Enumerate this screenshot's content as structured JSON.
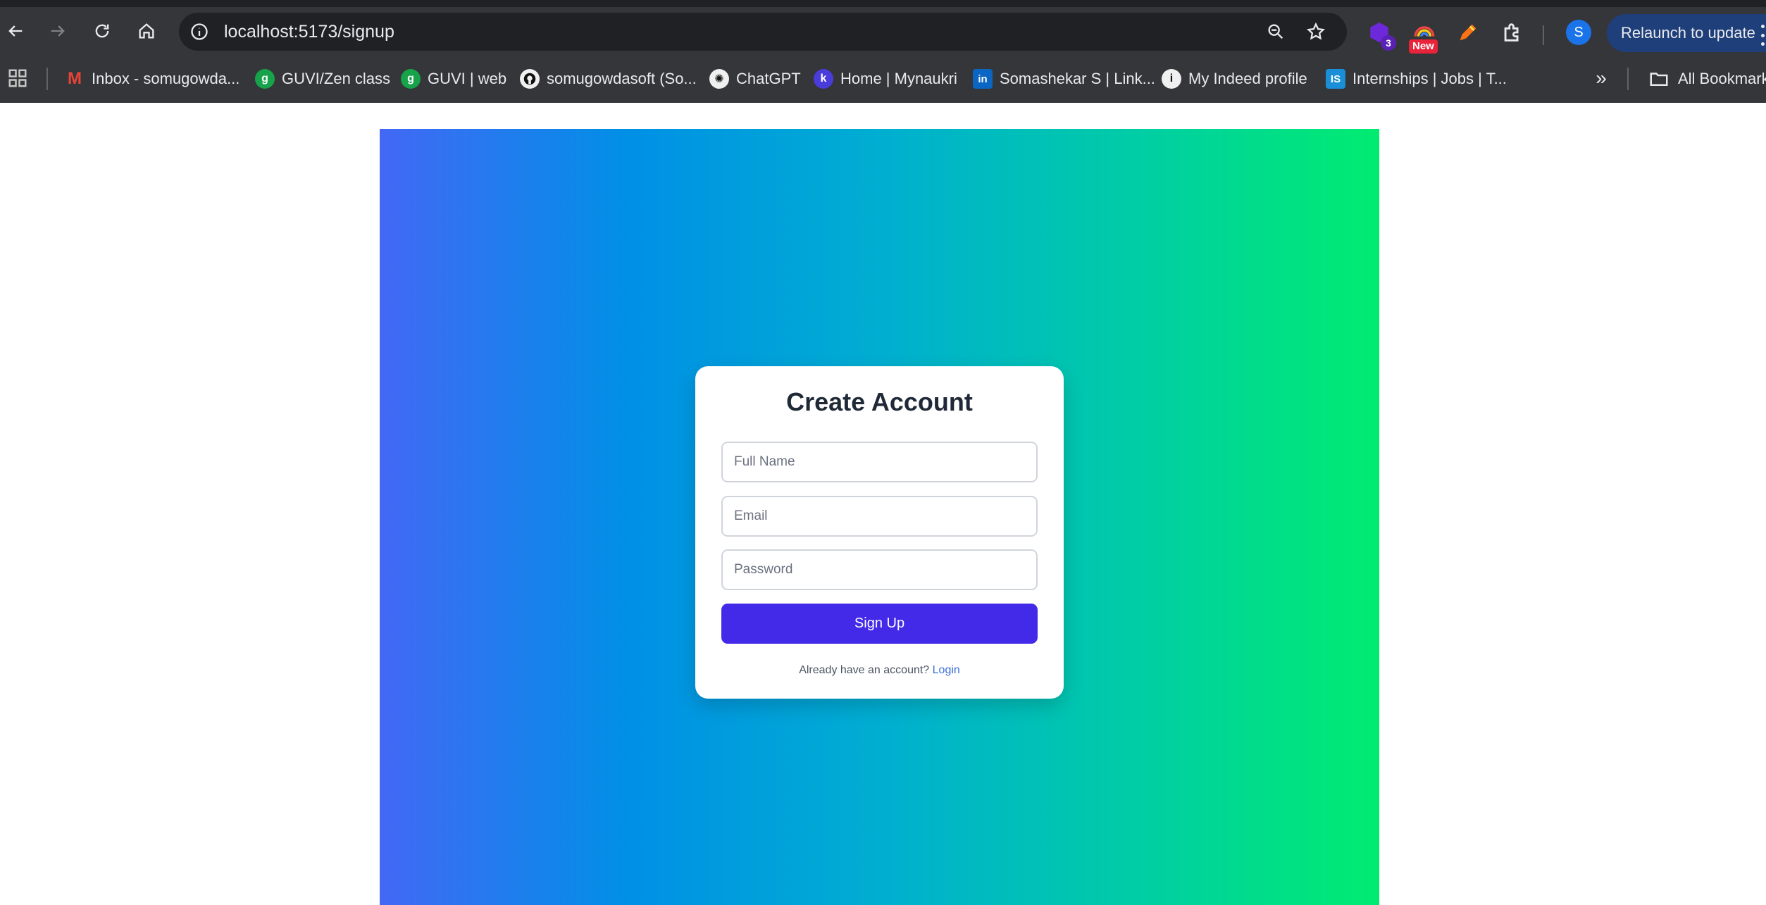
{
  "browser": {
    "url": "localhost:5173/signup",
    "relaunch_label": "Relaunch to update",
    "profile_initial": "S",
    "extensions": [
      {
        "name": "extension-purple",
        "badge": "3"
      },
      {
        "name": "extension-rainbow",
        "badge": "New"
      },
      {
        "name": "extension-pen"
      },
      {
        "name": "extensions-puzzle"
      }
    ],
    "bookmarks": [
      {
        "label": "Inbox - somugowda...",
        "icon": "gmail-icon",
        "color": "#ea4335",
        "glyph": "M"
      },
      {
        "label": "GUVI/Zen class",
        "icon": "guvi-icon",
        "color": "#16a34a",
        "glyph": "g"
      },
      {
        "label": "GUVI | web",
        "icon": "guvi-icon",
        "color": "#16a34a",
        "glyph": "g"
      },
      {
        "label": "somugowdasoft (So...",
        "icon": "github-icon",
        "color": "#f0f0f0",
        "glyph": "●"
      },
      {
        "label": "ChatGPT",
        "icon": "chatgpt-icon",
        "color": "#f0f0f0",
        "glyph": "✺"
      },
      {
        "label": "Home | Mynaukri",
        "icon": "naukri-icon",
        "color": "#4a3bdb",
        "glyph": "k"
      },
      {
        "label": "Somashekar S | Link...",
        "icon": "linkedin-icon",
        "color": "#0a66c2",
        "glyph": "in"
      },
      {
        "label": "My Indeed profile",
        "icon": "indeed-icon",
        "color": "#f0f0f0",
        "glyph": "i"
      },
      {
        "label": "Internships | Jobs | T...",
        "icon": "internshala-icon",
        "color": "#1a8fd8",
        "glyph": "IS"
      }
    ],
    "all_bookmarks_label": "All Bookmarks"
  },
  "form": {
    "title": "Create Account",
    "full_name_placeholder": "Full Name",
    "email_placeholder": "Email",
    "password_placeholder": "Password",
    "submit_label": "Sign Up",
    "login_prompt": "Already have an account?",
    "login_link": "Login"
  },
  "colors": {
    "gradient_start": "#4368f5",
    "gradient_end": "#00ec70",
    "button": "#432ae8",
    "link": "#3b6fd9"
  }
}
